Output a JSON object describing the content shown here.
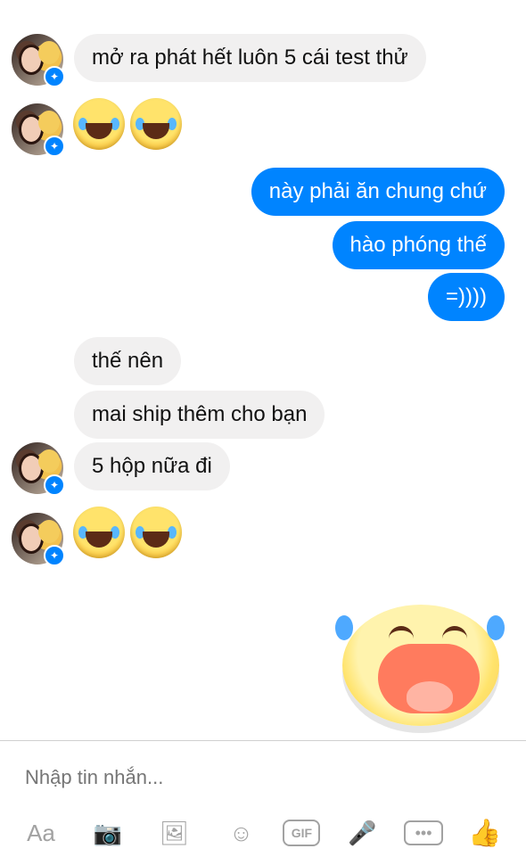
{
  "colors": {
    "outgoing_bubble": "#0084ff",
    "incoming_bubble": "#f1f0f0",
    "like_icon": "#0084ff",
    "toolbar_icon": "#a2a2a2"
  },
  "messages": {
    "m1": "mở ra phát hết luôn 5 cái test thử",
    "m3": "này phải ăn chung chứ",
    "m4": "hào phóng thế",
    "m5": "=))))",
    "m6": "thế nên",
    "m7": "mai ship thêm cho bạn",
    "m8": "5 hộp nữa đi"
  },
  "composer": {
    "placeholder": "Nhập tin nhắn..."
  },
  "toolbar": {
    "aa_label": "Aa",
    "gif_label": "GIF",
    "icons": [
      "camera-icon",
      "gallery-icon",
      "emoji-icon",
      "gif-icon",
      "microphone-icon",
      "more-icon",
      "like-icon"
    ]
  }
}
